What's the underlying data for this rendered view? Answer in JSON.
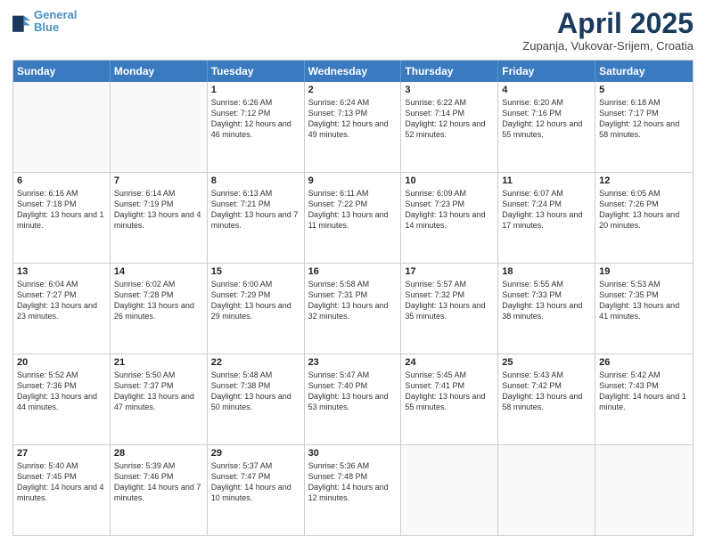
{
  "header": {
    "logo_line1": "General",
    "logo_line2": "Blue",
    "month_title": "April 2025",
    "location": "Zupanja, Vukovar-Srijem, Croatia"
  },
  "weekdays": [
    "Sunday",
    "Monday",
    "Tuesday",
    "Wednesday",
    "Thursday",
    "Friday",
    "Saturday"
  ],
  "rows": [
    [
      {
        "day": "",
        "sunrise": "",
        "sunset": "",
        "daylight": "",
        "empty": true
      },
      {
        "day": "",
        "sunrise": "",
        "sunset": "",
        "daylight": "",
        "empty": true
      },
      {
        "day": "1",
        "sunrise": "Sunrise: 6:26 AM",
        "sunset": "Sunset: 7:12 PM",
        "daylight": "Daylight: 12 hours and 46 minutes.",
        "empty": false
      },
      {
        "day": "2",
        "sunrise": "Sunrise: 6:24 AM",
        "sunset": "Sunset: 7:13 PM",
        "daylight": "Daylight: 12 hours and 49 minutes.",
        "empty": false
      },
      {
        "day": "3",
        "sunrise": "Sunrise: 6:22 AM",
        "sunset": "Sunset: 7:14 PM",
        "daylight": "Daylight: 12 hours and 52 minutes.",
        "empty": false
      },
      {
        "day": "4",
        "sunrise": "Sunrise: 6:20 AM",
        "sunset": "Sunset: 7:16 PM",
        "daylight": "Daylight: 12 hours and 55 minutes.",
        "empty": false
      },
      {
        "day": "5",
        "sunrise": "Sunrise: 6:18 AM",
        "sunset": "Sunset: 7:17 PM",
        "daylight": "Daylight: 12 hours and 58 minutes.",
        "empty": false
      }
    ],
    [
      {
        "day": "6",
        "sunrise": "Sunrise: 6:16 AM",
        "sunset": "Sunset: 7:18 PM",
        "daylight": "Daylight: 13 hours and 1 minute.",
        "empty": false
      },
      {
        "day": "7",
        "sunrise": "Sunrise: 6:14 AM",
        "sunset": "Sunset: 7:19 PM",
        "daylight": "Daylight: 13 hours and 4 minutes.",
        "empty": false
      },
      {
        "day": "8",
        "sunrise": "Sunrise: 6:13 AM",
        "sunset": "Sunset: 7:21 PM",
        "daylight": "Daylight: 13 hours and 7 minutes.",
        "empty": false
      },
      {
        "day": "9",
        "sunrise": "Sunrise: 6:11 AM",
        "sunset": "Sunset: 7:22 PM",
        "daylight": "Daylight: 13 hours and 11 minutes.",
        "empty": false
      },
      {
        "day": "10",
        "sunrise": "Sunrise: 6:09 AM",
        "sunset": "Sunset: 7:23 PM",
        "daylight": "Daylight: 13 hours and 14 minutes.",
        "empty": false
      },
      {
        "day": "11",
        "sunrise": "Sunrise: 6:07 AM",
        "sunset": "Sunset: 7:24 PM",
        "daylight": "Daylight: 13 hours and 17 minutes.",
        "empty": false
      },
      {
        "day": "12",
        "sunrise": "Sunrise: 6:05 AM",
        "sunset": "Sunset: 7:26 PM",
        "daylight": "Daylight: 13 hours and 20 minutes.",
        "empty": false
      }
    ],
    [
      {
        "day": "13",
        "sunrise": "Sunrise: 6:04 AM",
        "sunset": "Sunset: 7:27 PM",
        "daylight": "Daylight: 13 hours and 23 minutes.",
        "empty": false
      },
      {
        "day": "14",
        "sunrise": "Sunrise: 6:02 AM",
        "sunset": "Sunset: 7:28 PM",
        "daylight": "Daylight: 13 hours and 26 minutes.",
        "empty": false
      },
      {
        "day": "15",
        "sunrise": "Sunrise: 6:00 AM",
        "sunset": "Sunset: 7:29 PM",
        "daylight": "Daylight: 13 hours and 29 minutes.",
        "empty": false
      },
      {
        "day": "16",
        "sunrise": "Sunrise: 5:58 AM",
        "sunset": "Sunset: 7:31 PM",
        "daylight": "Daylight: 13 hours and 32 minutes.",
        "empty": false
      },
      {
        "day": "17",
        "sunrise": "Sunrise: 5:57 AM",
        "sunset": "Sunset: 7:32 PM",
        "daylight": "Daylight: 13 hours and 35 minutes.",
        "empty": false
      },
      {
        "day": "18",
        "sunrise": "Sunrise: 5:55 AM",
        "sunset": "Sunset: 7:33 PM",
        "daylight": "Daylight: 13 hours and 38 minutes.",
        "empty": false
      },
      {
        "day": "19",
        "sunrise": "Sunrise: 5:53 AM",
        "sunset": "Sunset: 7:35 PM",
        "daylight": "Daylight: 13 hours and 41 minutes.",
        "empty": false
      }
    ],
    [
      {
        "day": "20",
        "sunrise": "Sunrise: 5:52 AM",
        "sunset": "Sunset: 7:36 PM",
        "daylight": "Daylight: 13 hours and 44 minutes.",
        "empty": false
      },
      {
        "day": "21",
        "sunrise": "Sunrise: 5:50 AM",
        "sunset": "Sunset: 7:37 PM",
        "daylight": "Daylight: 13 hours and 47 minutes.",
        "empty": false
      },
      {
        "day": "22",
        "sunrise": "Sunrise: 5:48 AM",
        "sunset": "Sunset: 7:38 PM",
        "daylight": "Daylight: 13 hours and 50 minutes.",
        "empty": false
      },
      {
        "day": "23",
        "sunrise": "Sunrise: 5:47 AM",
        "sunset": "Sunset: 7:40 PM",
        "daylight": "Daylight: 13 hours and 53 minutes.",
        "empty": false
      },
      {
        "day": "24",
        "sunrise": "Sunrise: 5:45 AM",
        "sunset": "Sunset: 7:41 PM",
        "daylight": "Daylight: 13 hours and 55 minutes.",
        "empty": false
      },
      {
        "day": "25",
        "sunrise": "Sunrise: 5:43 AM",
        "sunset": "Sunset: 7:42 PM",
        "daylight": "Daylight: 13 hours and 58 minutes.",
        "empty": false
      },
      {
        "day": "26",
        "sunrise": "Sunrise: 5:42 AM",
        "sunset": "Sunset: 7:43 PM",
        "daylight": "Daylight: 14 hours and 1 minute.",
        "empty": false
      }
    ],
    [
      {
        "day": "27",
        "sunrise": "Sunrise: 5:40 AM",
        "sunset": "Sunset: 7:45 PM",
        "daylight": "Daylight: 14 hours and 4 minutes.",
        "empty": false
      },
      {
        "day": "28",
        "sunrise": "Sunrise: 5:39 AM",
        "sunset": "Sunset: 7:46 PM",
        "daylight": "Daylight: 14 hours and 7 minutes.",
        "empty": false
      },
      {
        "day": "29",
        "sunrise": "Sunrise: 5:37 AM",
        "sunset": "Sunset: 7:47 PM",
        "daylight": "Daylight: 14 hours and 10 minutes.",
        "empty": false
      },
      {
        "day": "30",
        "sunrise": "Sunrise: 5:36 AM",
        "sunset": "Sunset: 7:48 PM",
        "daylight": "Daylight: 14 hours and 12 minutes.",
        "empty": false
      },
      {
        "day": "",
        "sunrise": "",
        "sunset": "",
        "daylight": "",
        "empty": true
      },
      {
        "day": "",
        "sunrise": "",
        "sunset": "",
        "daylight": "",
        "empty": true
      },
      {
        "day": "",
        "sunrise": "",
        "sunset": "",
        "daylight": "",
        "empty": true
      }
    ]
  ]
}
